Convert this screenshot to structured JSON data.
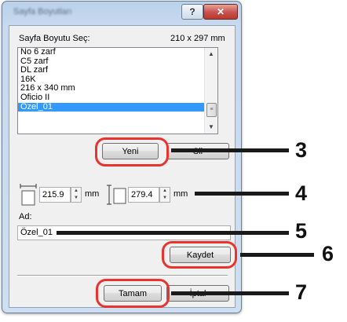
{
  "window": {
    "title": "Sayfa Boyutları",
    "help_label": "?",
    "close_label": "✕"
  },
  "page_size": {
    "label": "Sayfa Boyutu Seç:",
    "current_dimensions": "210 x 297 mm",
    "items": [
      {
        "label": "No 6 zarf"
      },
      {
        "label": "C5 zarf"
      },
      {
        "label": "DL zarf"
      },
      {
        "label": "16K"
      },
      {
        "label": "216 x 340 mm"
      },
      {
        "label": "Oficio II"
      },
      {
        "label": "Özel_01",
        "selected": true
      }
    ]
  },
  "buttons": {
    "new_label": "Yeni",
    "delete_label": "Sil",
    "save_label": "Kaydet",
    "ok_label": "Tamam",
    "cancel_label": "İptal"
  },
  "dimensions": {
    "width_value": "215.9",
    "height_value": "279.4",
    "unit": "mm"
  },
  "name": {
    "label": "Ad:",
    "value": "Özel_01"
  },
  "callouts": [
    "3",
    "4",
    "5",
    "6",
    "7"
  ],
  "colors": {
    "highlight": "#e8342c",
    "selection": "#3399ff"
  }
}
